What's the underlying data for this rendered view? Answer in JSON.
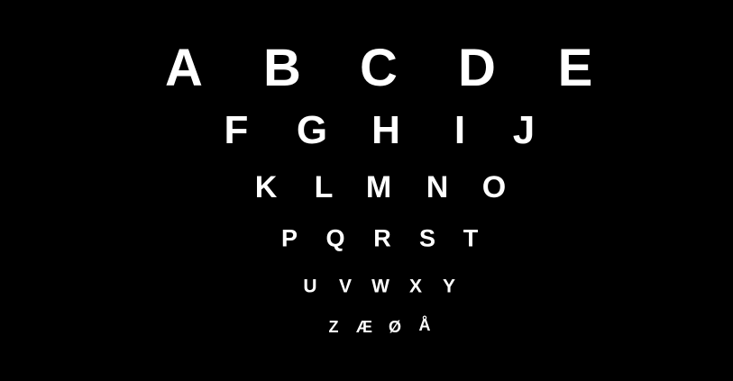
{
  "eye_chart": {
    "background": "#000000",
    "letter_color": "#ffffff",
    "rows": [
      {
        "letters": [
          "A",
          "B",
          "C",
          "D",
          "E"
        ]
      },
      {
        "letters": [
          "F",
          "G",
          "H",
          "I",
          "J"
        ]
      },
      {
        "letters": [
          "K",
          "L",
          "M",
          "N",
          "O"
        ]
      },
      {
        "letters": [
          "P",
          "Q",
          "R",
          "S",
          "T"
        ]
      },
      {
        "letters": [
          "U",
          "V",
          "W",
          "X",
          "Y"
        ]
      },
      {
        "letters": [
          "Z",
          "Æ",
          "Ø",
          "Å"
        ]
      }
    ]
  }
}
